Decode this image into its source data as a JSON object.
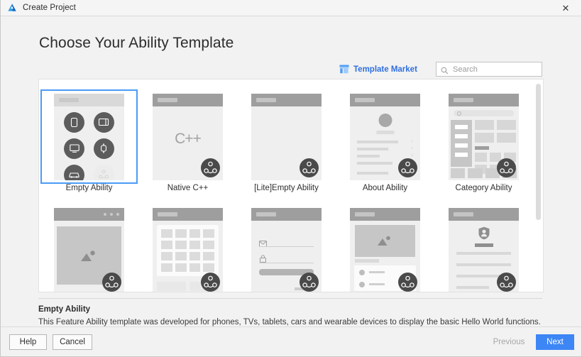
{
  "window": {
    "title": "Create Project",
    "app_icon": "deveco-triangle-icon",
    "close_label": "✕"
  },
  "heading": "Choose Your Ability Template",
  "toolbar": {
    "market_label": "Template Market",
    "market_icon": "store-icon",
    "market_color": "#2f6fe0",
    "search_icon": "search-icon",
    "search_value": "",
    "search_placeholder": "Search"
  },
  "templates": [
    {
      "label": "Empty Ability",
      "thumb": "devices",
      "selected": true
    },
    {
      "label": "Native C++",
      "thumb": "cpp",
      "selected": false,
      "logo": "C++"
    },
    {
      "label": "[Lite]Empty Ability",
      "thumb": "blank",
      "selected": false
    },
    {
      "label": "About Ability",
      "thumb": "about",
      "selected": false
    },
    {
      "label": "Category Ability",
      "thumb": "category",
      "selected": false
    },
    {
      "label": "",
      "thumb": "gallery",
      "selected": false
    },
    {
      "label": "",
      "thumb": "grid",
      "selected": false
    },
    {
      "label": "",
      "thumb": "login",
      "selected": false
    },
    {
      "label": "",
      "thumb": "feed",
      "selected": false
    },
    {
      "label": "",
      "thumb": "profile",
      "selected": false
    }
  ],
  "device_icons": [
    "phone-icon",
    "tablet-icon",
    "tv-icon",
    "watch-icon",
    "car-icon",
    "atom-icon"
  ],
  "description": {
    "title": "Empty Ability",
    "text": "This Feature Ability template was developed for phones, TVs, tablets, cars and wearable devices to display the basic Hello World functions."
  },
  "footer": {
    "help": "Help",
    "cancel": "Cancel",
    "previous": "Previous",
    "next": "Next",
    "next_color": "#3d86f5"
  },
  "scrollbar": {
    "thumb_color": "#dcdcdc"
  }
}
